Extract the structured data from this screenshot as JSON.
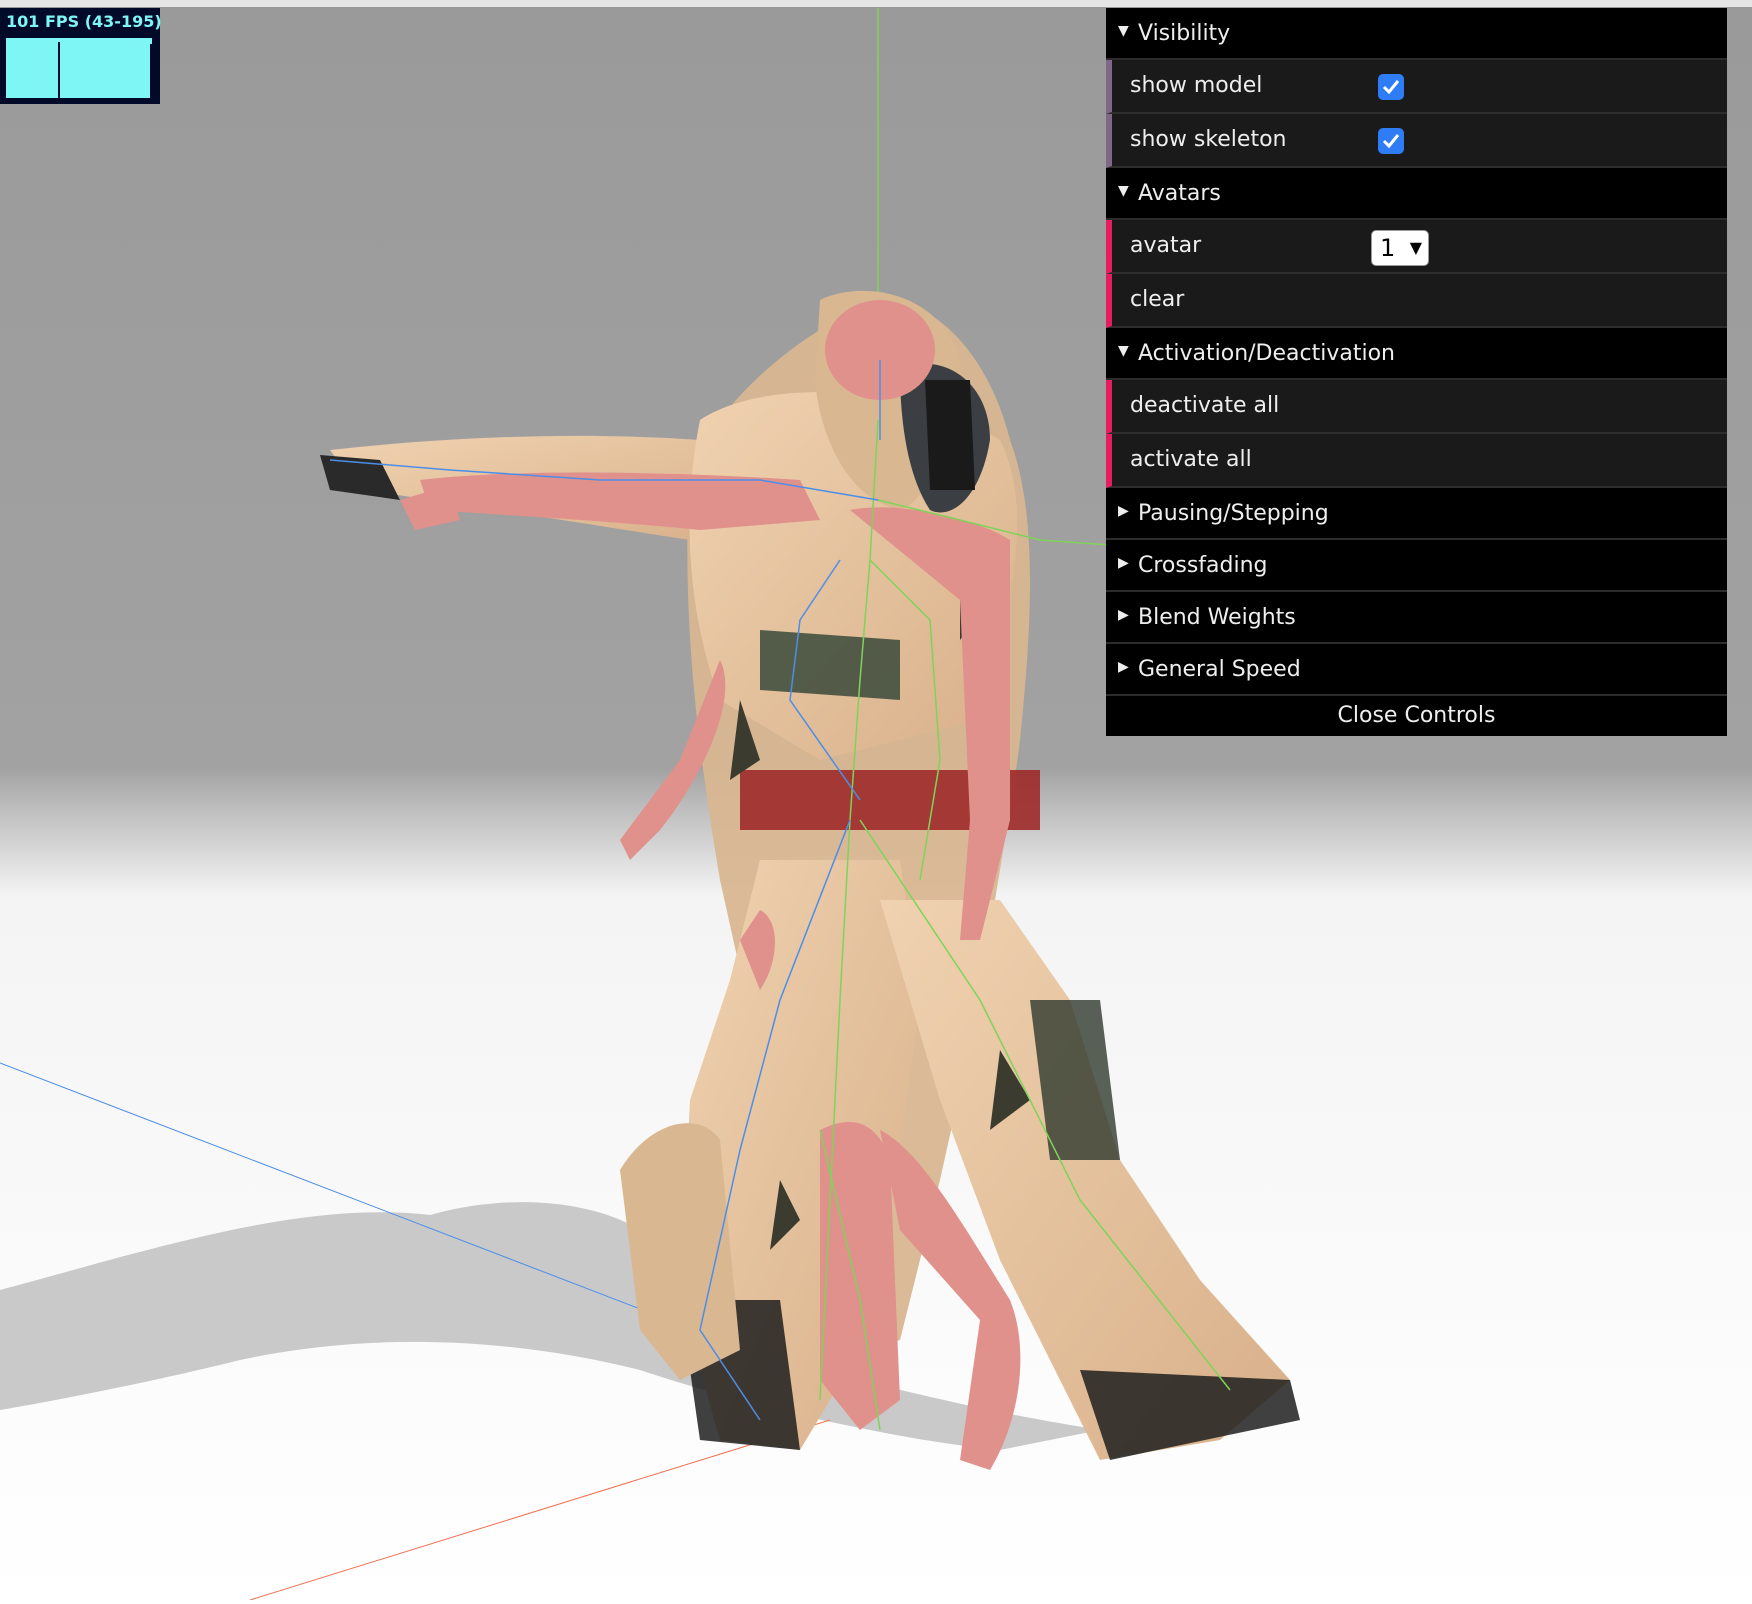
{
  "stats": {
    "fps_text": "101 FPS (43-195)"
  },
  "gui": {
    "folders": {
      "visibility": {
        "title": "Visibility",
        "expanded": true
      },
      "avatars": {
        "title": "Avatars",
        "expanded": true
      },
      "activation": {
        "title": "Activation/Deactivation",
        "expanded": true
      },
      "pausing": {
        "title": "Pausing/Stepping",
        "expanded": false
      },
      "crossfading": {
        "title": "Crossfading",
        "expanded": false
      },
      "blend": {
        "title": "Blend Weights",
        "expanded": false
      },
      "speed": {
        "title": "General Speed",
        "expanded": false
      }
    },
    "controls": {
      "show_model": {
        "label": "show model",
        "checked": true
      },
      "show_skeleton": {
        "label": "show skeleton",
        "checked": true
      },
      "avatar": {
        "label": "avatar",
        "value": "1"
      },
      "clear": {
        "label": "clear"
      },
      "deactivate_all": {
        "label": "deactivate all"
      },
      "activate_all": {
        "label": "activate all"
      }
    },
    "close_label": "Close Controls"
  },
  "colors": {
    "stats_fg": "#7ff6f6",
    "stats_bg": "#020a2a",
    "bool_accent": "#806787",
    "func_accent": "#e61d5f",
    "checkbox": "#2e7cf6",
    "skin_armor": "#e8c4a0",
    "skin_pink": "#e0918c",
    "axis_green": "#7fd35a",
    "axis_blue": "#4b8ee8",
    "axis_red": "#f07050"
  }
}
